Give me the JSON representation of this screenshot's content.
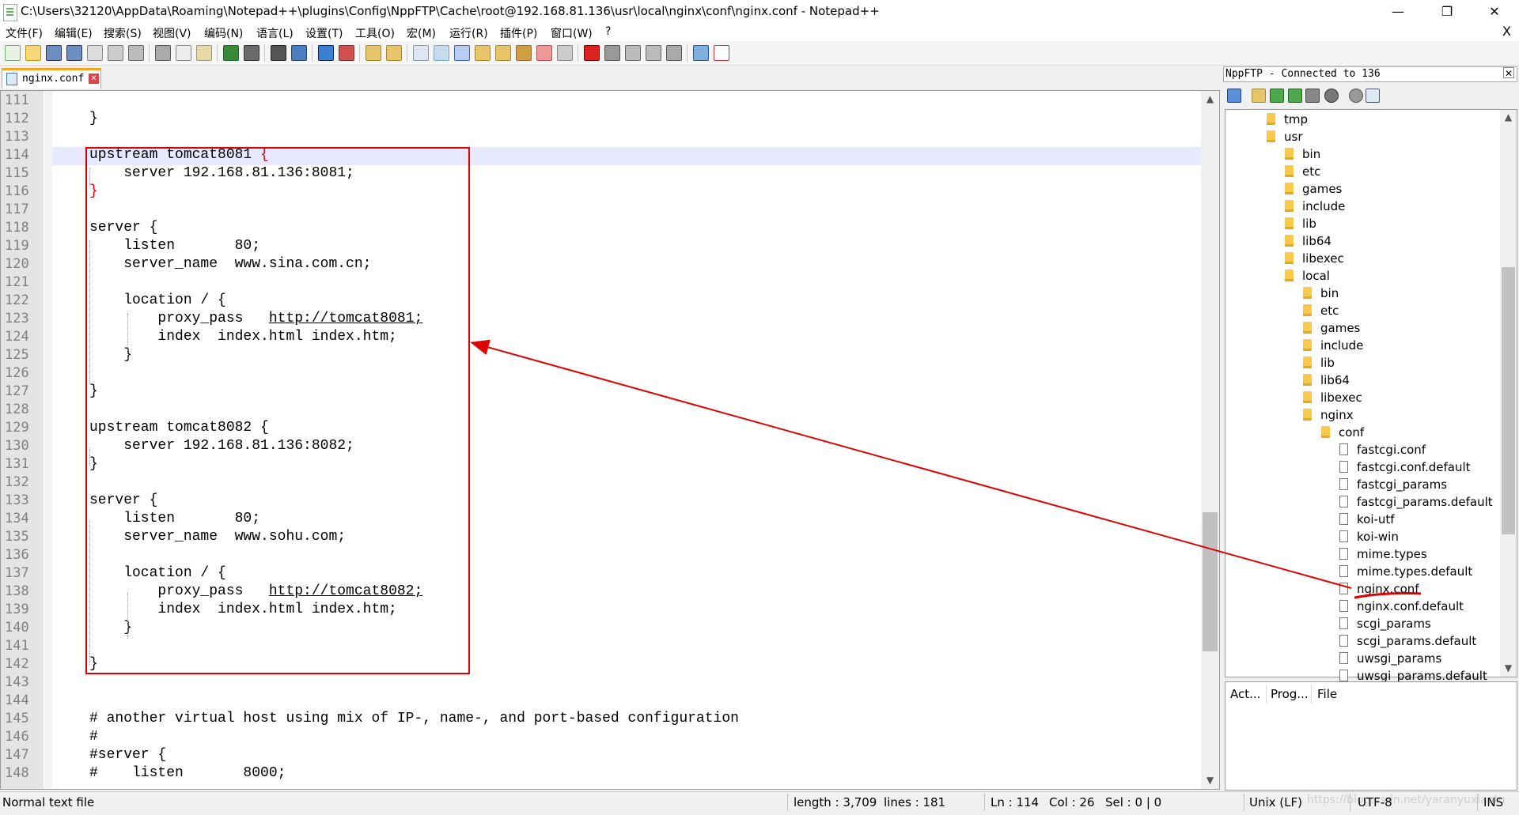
{
  "window": {
    "title": "C:\\Users\\32120\\AppData\\Roaming\\Notepad++\\plugins\\Config\\NppFTP\\Cache\\root@192.168.81.136\\usr\\local\\nginx\\conf\\nginx.conf - Notepad++",
    "min": "—",
    "max": "❐",
    "close": "✕"
  },
  "menu": [
    "文件(F)",
    "编辑(E)",
    "搜索(S)",
    "视图(V)",
    "编码(N)",
    "语言(L)",
    "设置(T)",
    "工具(O)",
    "宏(M)",
    "运行(R)",
    "插件(P)",
    "窗口(W)",
    "?"
  ],
  "menu_close": "X",
  "tab": {
    "label": "nginx.conf",
    "close": "✕"
  },
  "editor": {
    "lines": [
      {
        "n": "111",
        "text": ""
      },
      {
        "n": "112",
        "text": "}"
      },
      {
        "n": "113",
        "text": ""
      },
      {
        "n": "114",
        "text": "upstream tomcat8081 "
      },
      {
        "n": "115",
        "text": "    server 192.168.81.136:8081;"
      },
      {
        "n": "116",
        "text": ""
      },
      {
        "n": "117",
        "text": ""
      },
      {
        "n": "118",
        "text": "server {"
      },
      {
        "n": "119",
        "text": "    listen       80;"
      },
      {
        "n": "120",
        "text": "    server_name  www.sina.com.cn;"
      },
      {
        "n": "121",
        "text": ""
      },
      {
        "n": "122",
        "text": "    location / {"
      },
      {
        "n": "123",
        "text": "        proxy_pass   "
      },
      {
        "n": "124",
        "text": "        index  index.html index.htm;"
      },
      {
        "n": "125",
        "text": "    }"
      },
      {
        "n": "126",
        "text": ""
      },
      {
        "n": "127",
        "text": "}"
      },
      {
        "n": "128",
        "text": ""
      },
      {
        "n": "129",
        "text": "upstream tomcat8082 {"
      },
      {
        "n": "130",
        "text": "    server 192.168.81.136:8082;"
      },
      {
        "n": "131",
        "text": "}"
      },
      {
        "n": "132",
        "text": ""
      },
      {
        "n": "133",
        "text": "server {"
      },
      {
        "n": "134",
        "text": "    listen       80;"
      },
      {
        "n": "135",
        "text": "    server_name  www.sohu.com;"
      },
      {
        "n": "136",
        "text": ""
      },
      {
        "n": "137",
        "text": "    location / {"
      },
      {
        "n": "138",
        "text": "        proxy_pass   "
      },
      {
        "n": "139",
        "text": "        index  index.html index.htm;"
      },
      {
        "n": "140",
        "text": "    }"
      },
      {
        "n": "141",
        "text": ""
      },
      {
        "n": "142",
        "text": "}"
      },
      {
        "n": "143",
        "text": ""
      },
      {
        "n": "144",
        "text": ""
      },
      {
        "n": "145",
        "text": "# another virtual host using mix of IP-, name-, and port-based configuration"
      },
      {
        "n": "146",
        "text": "#"
      },
      {
        "n": "147",
        "text": "#server {"
      },
      {
        "n": "148",
        "text": "#    listen       8000;"
      }
    ],
    "brace_open": "{",
    "brace_close": "}",
    "link1": "http://tomcat8081;",
    "link2": "http://tomcat8082;"
  },
  "ftp": {
    "title": "NppFTP - Connected to 136",
    "close": "✕",
    "tree": [
      {
        "label": "tmp",
        "type": "folder",
        "level": 0
      },
      {
        "label": "usr",
        "type": "folder",
        "level": 0
      },
      {
        "label": "bin",
        "type": "folder",
        "level": 1
      },
      {
        "label": "etc",
        "type": "folder",
        "level": 1
      },
      {
        "label": "games",
        "type": "folder",
        "level": 1
      },
      {
        "label": "include",
        "type": "folder",
        "level": 1
      },
      {
        "label": "lib",
        "type": "folder",
        "level": 1
      },
      {
        "label": "lib64",
        "type": "folder",
        "level": 1
      },
      {
        "label": "libexec",
        "type": "folder",
        "level": 1
      },
      {
        "label": "local",
        "type": "folder",
        "level": 1
      },
      {
        "label": "bin",
        "type": "folder",
        "level": 2
      },
      {
        "label": "etc",
        "type": "folder",
        "level": 2
      },
      {
        "label": "games",
        "type": "folder",
        "level": 2
      },
      {
        "label": "include",
        "type": "folder",
        "level": 2
      },
      {
        "label": "lib",
        "type": "folder",
        "level": 2
      },
      {
        "label": "lib64",
        "type": "folder",
        "level": 2
      },
      {
        "label": "libexec",
        "type": "folder",
        "level": 2
      },
      {
        "label": "nginx",
        "type": "folder",
        "level": 2
      },
      {
        "label": "conf",
        "type": "folder",
        "level": 3
      },
      {
        "label": "fastcgi.conf",
        "type": "file",
        "level": 4
      },
      {
        "label": "fastcgi.conf.default",
        "type": "file",
        "level": 4
      },
      {
        "label": "fastcgi_params",
        "type": "file",
        "level": 4
      },
      {
        "label": "fastcgi_params.default",
        "type": "file",
        "level": 4
      },
      {
        "label": "koi-utf",
        "type": "file",
        "level": 4
      },
      {
        "label": "koi-win",
        "type": "file",
        "level": 4
      },
      {
        "label": "mime.types",
        "type": "file",
        "level": 4
      },
      {
        "label": "mime.types.default",
        "type": "file",
        "level": 4
      },
      {
        "label": "nginx.conf",
        "type": "file",
        "level": 4
      },
      {
        "label": "nginx.conf.default",
        "type": "file",
        "level": 4
      },
      {
        "label": "scgi_params",
        "type": "file",
        "level": 4
      },
      {
        "label": "scgi_params.default",
        "type": "file",
        "level": 4
      },
      {
        "label": "uwsgi_params",
        "type": "file",
        "level": 4
      },
      {
        "label": "uwsgi_params.default",
        "type": "file",
        "level": 4
      }
    ],
    "queue_headers": [
      "Act...",
      "Prog...",
      "File"
    ]
  },
  "status": {
    "type": "Normal text file",
    "length": "length : 3,709",
    "lines": "lines : 181",
    "ln": "Ln : 114",
    "col": "Col : 26",
    "sel": "Sel : 0 | 0",
    "eol": "Unix (LF)",
    "encoding": "UTF-8",
    "mode": "INS",
    "watermark": "https://blog.csdn.net/yaranyuxiaotu"
  },
  "colors": {
    "annotation": "#e00000",
    "current_line": "#e8e8ff",
    "brace_match": "#e00000"
  }
}
